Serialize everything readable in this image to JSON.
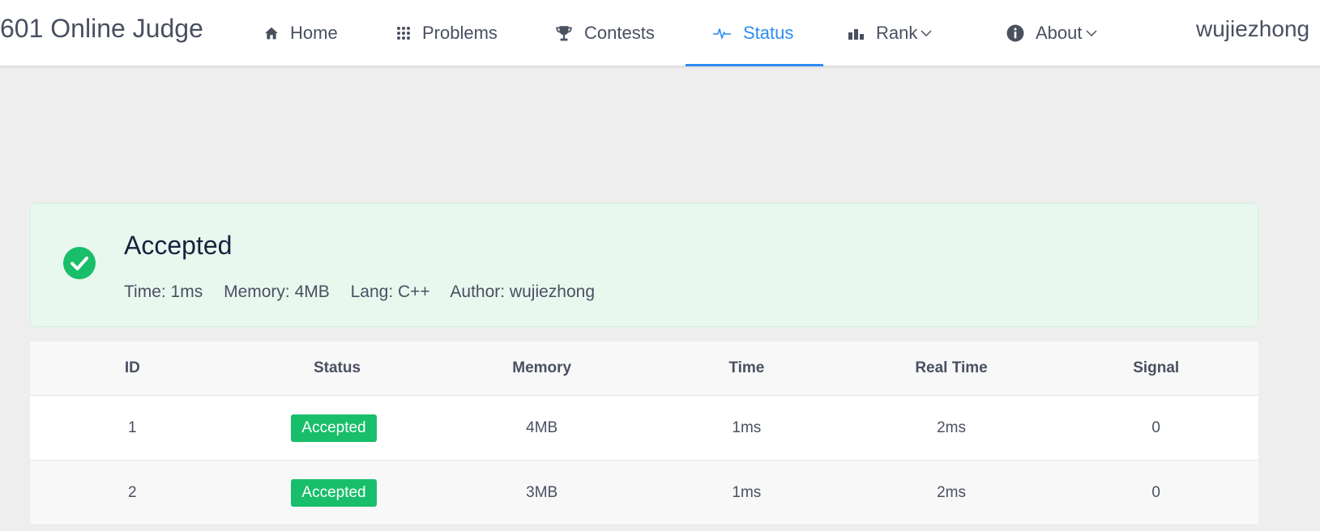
{
  "header": {
    "brand": "601 Online Judge",
    "nav": [
      {
        "label": "Home",
        "icon": "home-icon"
      },
      {
        "label": "Problems",
        "icon": "grid-icon"
      },
      {
        "label": "Contests",
        "icon": "trophy-icon"
      },
      {
        "label": "Status",
        "icon": "pulse-icon",
        "active": true
      },
      {
        "label": "Rank",
        "icon": "bar-chart-icon",
        "dropdown": true
      },
      {
        "label": "About",
        "icon": "info-icon",
        "dropdown": true
      }
    ],
    "username": "wujiezhong"
  },
  "result": {
    "title": "Accepted",
    "time": "Time: 1ms",
    "memory": "Memory: 4MB",
    "lang": "Lang: C++",
    "author": "Author: wujiezhong",
    "icon": "check-circle-icon"
  },
  "table": {
    "columns": [
      "ID",
      "Status",
      "Memory",
      "Time",
      "Real Time",
      "Signal"
    ],
    "rows": [
      {
        "id": "1",
        "status": "Accepted",
        "memory": "4MB",
        "time": "1ms",
        "real_time": "2ms",
        "signal": "0"
      },
      {
        "id": "2",
        "status": "Accepted",
        "memory": "3MB",
        "time": "1ms",
        "real_time": "2ms",
        "signal": "0"
      }
    ]
  },
  "colors": {
    "accent": "#2d8cf0",
    "success": "#19be6b",
    "success_bg": "#e9f8ef",
    "page_bg": "#eeeeee"
  }
}
